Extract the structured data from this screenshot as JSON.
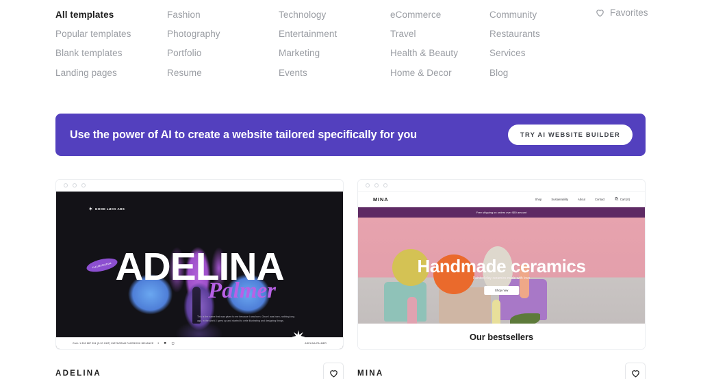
{
  "nav": {
    "columns": [
      [
        {
          "label": "All templates",
          "active": true
        },
        {
          "label": "Popular templates",
          "active": false
        },
        {
          "label": "Blank templates",
          "active": false
        },
        {
          "label": "Landing pages",
          "active": false
        }
      ],
      [
        {
          "label": "Fashion",
          "active": false
        },
        {
          "label": "Photography",
          "active": false
        },
        {
          "label": "Portfolio",
          "active": false
        },
        {
          "label": "Resume",
          "active": false
        }
      ],
      [
        {
          "label": "Technology",
          "active": false
        },
        {
          "label": "Entertainment",
          "active": false
        },
        {
          "label": "Marketing",
          "active": false
        },
        {
          "label": "Events",
          "active": false
        }
      ],
      [
        {
          "label": "eCommerce",
          "active": false
        },
        {
          "label": "Travel",
          "active": false
        },
        {
          "label": "Health & Beauty",
          "active": false
        },
        {
          "label": "Home & Decor",
          "active": false
        }
      ],
      [
        {
          "label": "Community",
          "active": false
        },
        {
          "label": "Restaurants",
          "active": false
        },
        {
          "label": "Services",
          "active": false
        },
        {
          "label": "Blog",
          "active": false
        }
      ]
    ],
    "favorites_label": "Favorites",
    "favorites_icon": "heart-icon"
  },
  "banner": {
    "text": "Use the power of AI to create a website tailored specifically for you",
    "button_label": "TRY AI WEBSITE BUILDER",
    "background_color": "#5340BE",
    "text_color": "#FFFFFF"
  },
  "templates": [
    {
      "name": "ADELINA",
      "favorite_icon": "heart-outline-icon",
      "preview": {
        "logo": "GOOD LUCK ADS",
        "badge": "ILLUSTRATOR",
        "title": "ADELINA",
        "subtitle": "Palmer",
        "paragraph": "This is the name that was given to me because I was born. Once I was born, nothing long ago, in the world. I grew up and started to write illustrating and designing things.",
        "footer_left": "CALL 1 800 887 394 (9-20 GMT) INSTAGRAM FACEBOOK BEHANCE",
        "footer_right": "ADELINA PALMER",
        "background_color": "#131217",
        "accent_color": "#B861E6"
      }
    },
    {
      "name": "MINA",
      "favorite_icon": "heart-outline-icon",
      "preview": {
        "logo": "MINA",
        "nav_links": [
          "Shop",
          "Sustainability",
          "About",
          "Contact"
        ],
        "cart_label": "Cart (0)",
        "announcement": "Free shipping on orders over $50 amount",
        "title": "Handmade ceramics",
        "subtitle": "Painted clay ceramics made with love",
        "button_label": "Shop now",
        "section_title": "Our bestsellers",
        "announcement_color": "#5E2A64",
        "hero_background_color": "#E7A3AE"
      }
    }
  ],
  "window_dots": [
    "dot-1",
    "dot-2",
    "dot-3"
  ]
}
